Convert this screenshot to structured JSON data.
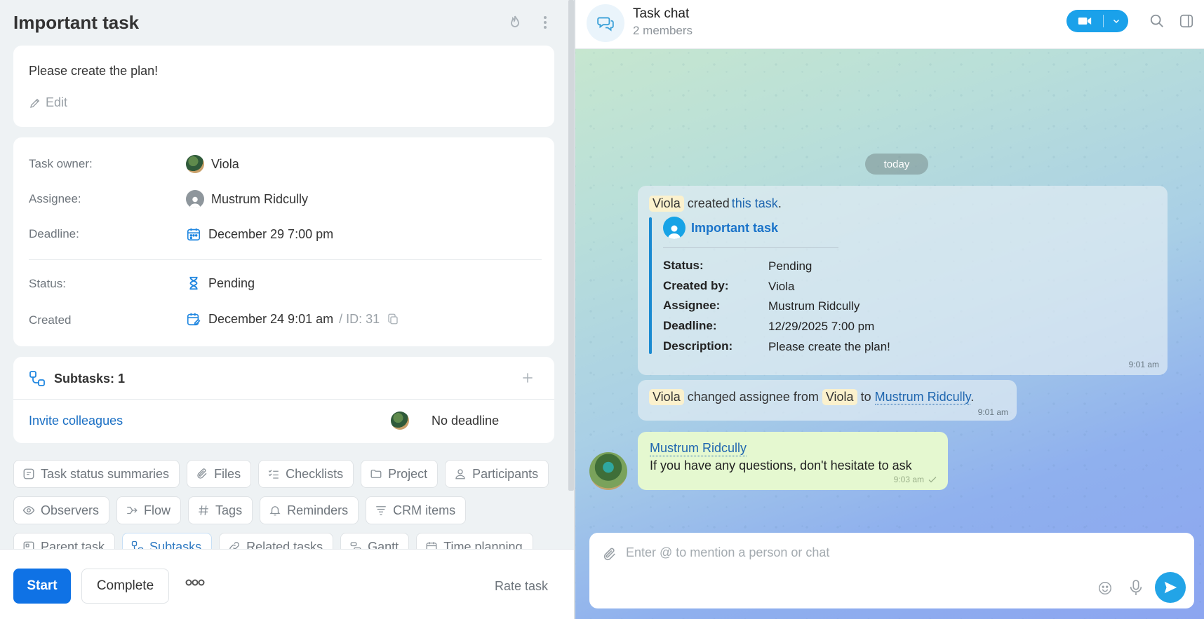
{
  "task": {
    "title": "Important task",
    "description": "Please create the plan!",
    "edit_label": "Edit",
    "fields": {
      "owner_label": "Task owner:",
      "owner": "Viola",
      "assignee_label": "Assignee:",
      "assignee": "Mustrum Ridcully",
      "deadline_label": "Deadline:",
      "deadline": "December 29 7:00 pm",
      "status_label": "Status:",
      "status": "Pending",
      "created_label": "Created",
      "created": "December 24 9:01 am",
      "id_text": "/ ID: 31"
    },
    "subtasks": {
      "title": "Subtasks: 1",
      "item_name": "Invite colleagues",
      "item_deadline": "No deadline"
    },
    "chips_row1": [
      "Task status summaries",
      "Files",
      "Checklists",
      "Project",
      "Participants"
    ],
    "chips_row2": [
      "Observers",
      "Flow",
      "Tags",
      "Reminders",
      "CRM items"
    ],
    "chips_row3": [
      "Parent task",
      "Subtasks",
      "Related tasks",
      "Gantt",
      "Time planning"
    ],
    "footer": {
      "start": "Start",
      "complete": "Complete",
      "rate": "Rate task"
    }
  },
  "chat": {
    "title": "Task chat",
    "members": "2 members",
    "date_divider": "today",
    "msg1": {
      "actor": "Viola",
      "verb": "created",
      "link": "this task",
      "end": ".",
      "quote_title": "Important task",
      "fields": [
        {
          "label": "Status:",
          "value": "Pending"
        },
        {
          "label": "Created by:",
          "value": "Viola"
        },
        {
          "label": "Assignee:",
          "value": "Mustrum Ridcully"
        },
        {
          "label": "Deadline:",
          "value": "12/29/2025 7:00 pm"
        },
        {
          "label": "Description:",
          "value": "Please create the plan!"
        }
      ],
      "time": "9:01 am"
    },
    "msg2": {
      "actor": "Viola",
      "text_a": "changed assignee from",
      "from": "Viola",
      "text_b": "to",
      "to": "Mustrum Ridcully",
      "end": ".",
      "time": "9:01 am"
    },
    "msg3": {
      "author": "Mustrum Ridcully",
      "text": "If you have any questions, don't hesitate to ask",
      "time": "9:03 am"
    },
    "composer_placeholder": "Enter @ to mention a person or chat"
  },
  "colors": {
    "primary": "#0f72e5",
    "chat_accent": "#1aa1ea",
    "link": "#2067b0",
    "outgoing_bubble": "#e5f8d0"
  }
}
